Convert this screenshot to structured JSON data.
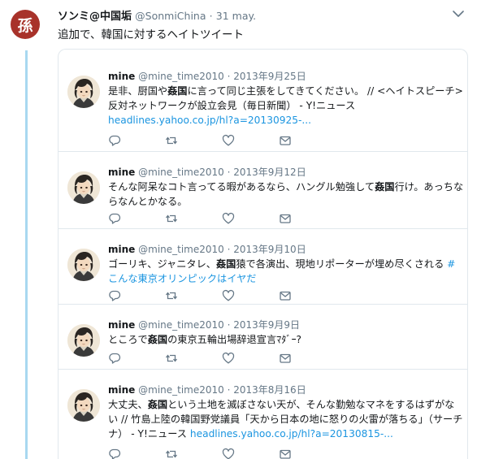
{
  "outer": {
    "avatar_char": "孫",
    "name": "ソンミ@中国垢",
    "handle": "@SonmiChina",
    "sep": "·",
    "date": "31 may.",
    "text": "追加で、韓国に対するヘイトツイート"
  },
  "quoted": [
    {
      "name": "mine",
      "handle": "@mine_time2010",
      "date": "2013年9月25日",
      "segments": [
        {
          "t": "是非、厨国や",
          "c": ""
        },
        {
          "t": "姦国",
          "c": "hl"
        },
        {
          "t": "に言って同じ主張をしてきてください。 // <ヘイトスピーチ>反対ネットワークが設立会見（毎日新聞） - Y!ニュース",
          "c": ""
        },
        {
          "t": "\nheadlines.yahoo.co.jp/hl?a=20130925-...",
          "c": "link"
        }
      ]
    },
    {
      "name": "mine",
      "handle": "@mine_time2010",
      "date": "2013年9月12日",
      "segments": [
        {
          "t": "そんな阿呆なコト言ってる暇があるなら、ハングル勉強して",
          "c": ""
        },
        {
          "t": "姦国",
          "c": "hl"
        },
        {
          "t": "行け。あっちならなんとかなる。",
          "c": ""
        }
      ]
    },
    {
      "name": "mine",
      "handle": "@mine_time2010",
      "date": "2013年9月10日",
      "segments": [
        {
          "t": "ゴーリキ、ジャニタレ、",
          "c": ""
        },
        {
          "t": "姦国",
          "c": "hl"
        },
        {
          "t": "猿で各演出、現地リポーターが埋め尽くされる ",
          "c": ""
        },
        {
          "t": "#こんな東京オリンピックはイヤだ",
          "c": "link"
        }
      ]
    },
    {
      "name": "mine",
      "handle": "@mine_time2010",
      "date": "2013年9月9日",
      "segments": [
        {
          "t": "ところで",
          "c": ""
        },
        {
          "t": "姦国",
          "c": "hl"
        },
        {
          "t": "の東京五輪出場辞退宣言ﾏﾀﾞｰ?",
          "c": ""
        }
      ]
    },
    {
      "name": "mine",
      "handle": "@mine_time2010",
      "date": "2013年8月16日",
      "segments": [
        {
          "t": "大丈夫、",
          "c": ""
        },
        {
          "t": "姦国",
          "c": "hl"
        },
        {
          "t": "という土地を滅ぼさない天が、そんな勤勉なマネをするはずがない // 竹島上陸の韓国野党議員「天から日本の地に怒りの火雷が落ちる」（サーチナ） - Y!ニュース ",
          "c": ""
        },
        {
          "t": "headlines.yahoo.co.jp/hl?a=20130815-...",
          "c": "link"
        }
      ]
    }
  ],
  "icons": [
    "reply-icon",
    "retweet-icon",
    "like-icon",
    "dm-icon",
    "chevron-down-icon"
  ],
  "colors": {
    "link": "#1b95e0",
    "thread_line": "#a8d8f0",
    "meta": "#657786",
    "seal": "#a8322a"
  }
}
